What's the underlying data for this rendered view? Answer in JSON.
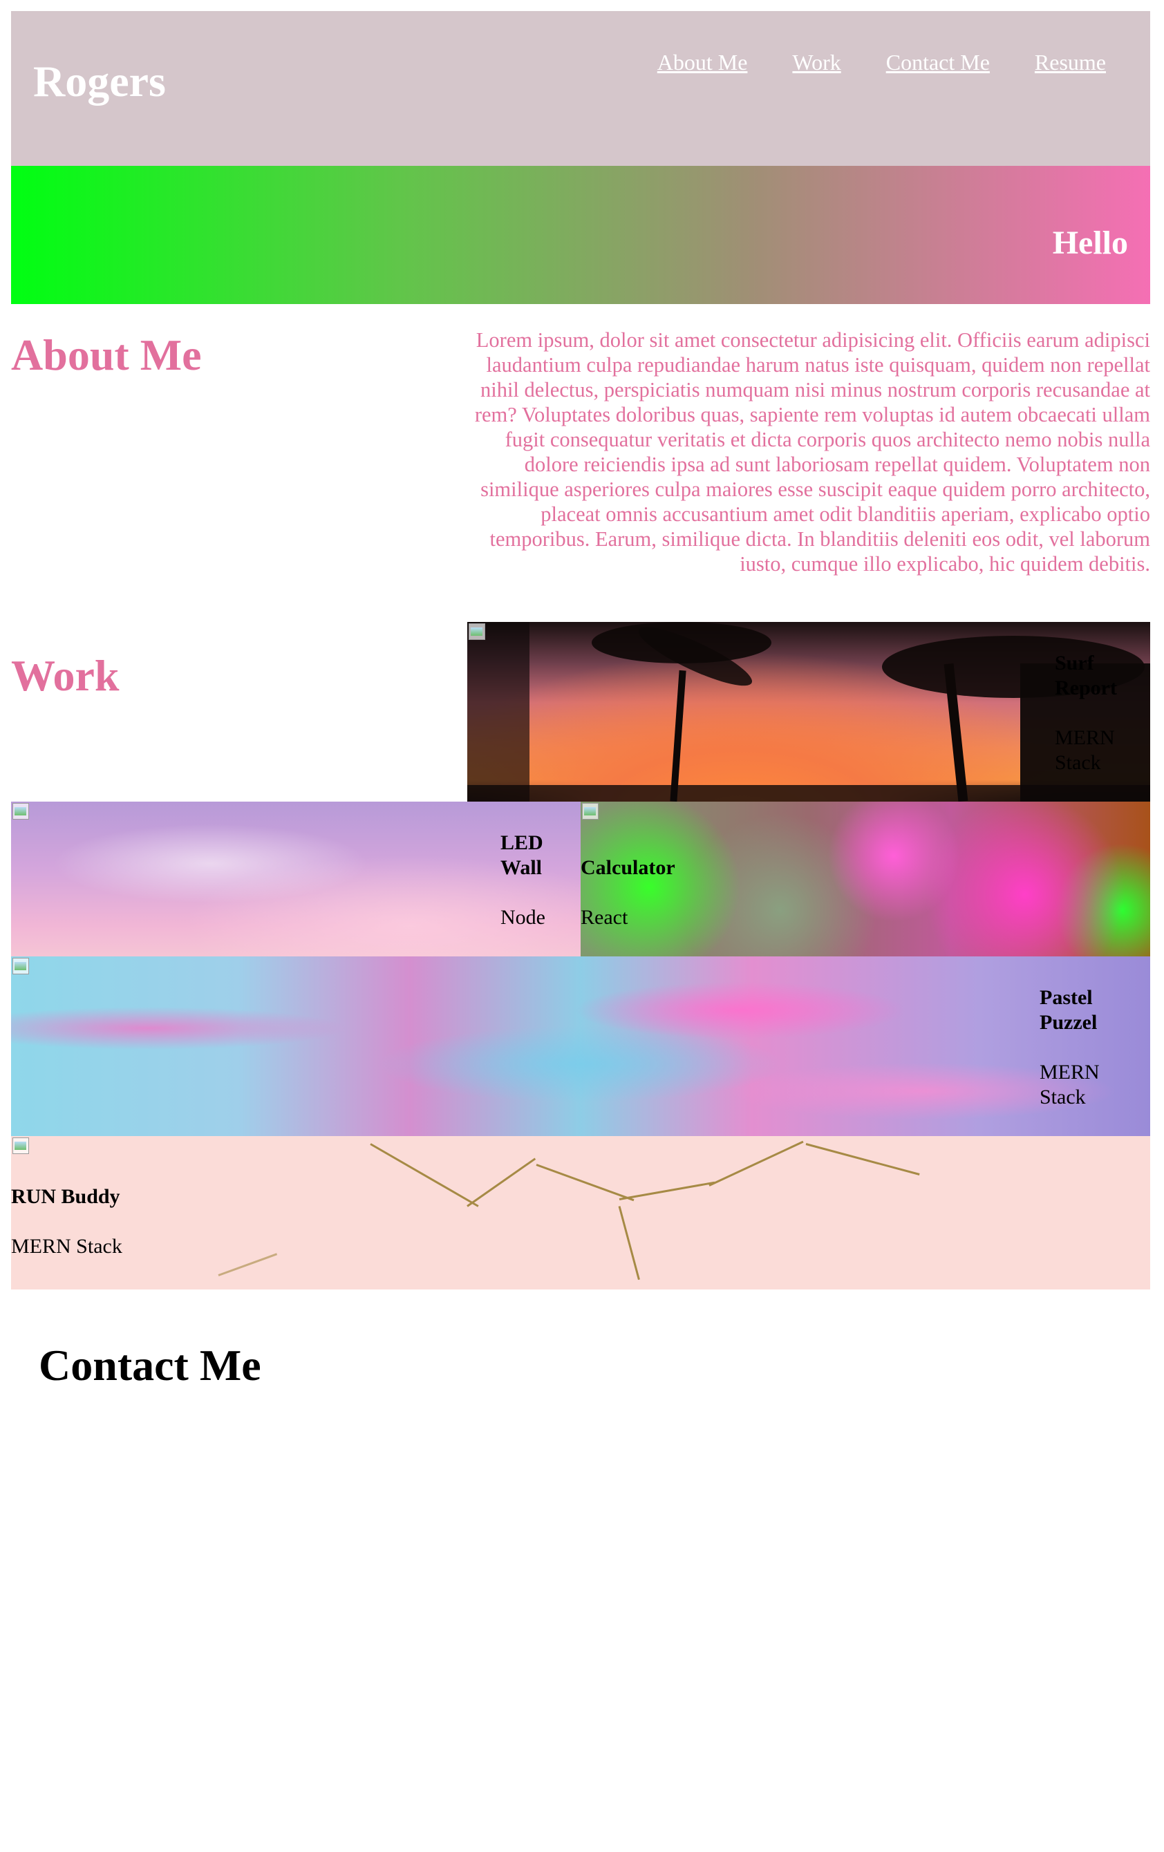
{
  "header": {
    "brand": "Rogers",
    "nav": [
      "About Me",
      "Work",
      "Contact Me",
      "Resume"
    ]
  },
  "hero": {
    "text": "Hello"
  },
  "about": {
    "title": "About Me",
    "text": "Lorem ipsum, dolor sit amet consectetur adipisicing elit. Officiis earum adipisci laudantium culpa repudiandae harum natus iste quisquam, quidem non repellat nihil delectus, perspiciatis numquam nisi minus nostrum corporis recusandae at rem? Voluptates doloribus quas, sapiente rem voluptas id autem obcaecati ullam fugit consequatur veritatis et dicta corporis quos architecto nemo nobis nulla dolore reiciendis ipsa ad sunt laboriosam repellat quidem. Voluptatem non similique asperiores culpa maiores esse suscipit eaque quidem porro architecto, placeat omnis accusantium amet odit blanditiis aperiam, explicabo optio temporibus. Earum, similique dicta. In blanditiis deleniti eos odit, vel laborum iusto, cumque illo explicabo, hic quidem debitis."
  },
  "work": {
    "title": "Work",
    "projects": [
      {
        "title": "Surf Report",
        "tech": "MERN Stack"
      },
      {
        "title": "LED Wall",
        "tech": "Node"
      },
      {
        "title": "Calculator",
        "tech": "React"
      },
      {
        "title": "Pastel Puzzel",
        "tech": "MERN Stack"
      },
      {
        "title": "RUN Buddy",
        "tech": "MERN Stack"
      }
    ]
  },
  "contact": {
    "title": "Contact Me"
  },
  "icons": {
    "broken_image": "broken-image-icon"
  },
  "colors": {
    "header_bg": "#d5c6cb",
    "accent_pink": "#e2709d",
    "gradient_start": "#00ff12",
    "gradient_end": "#f56fb4"
  }
}
